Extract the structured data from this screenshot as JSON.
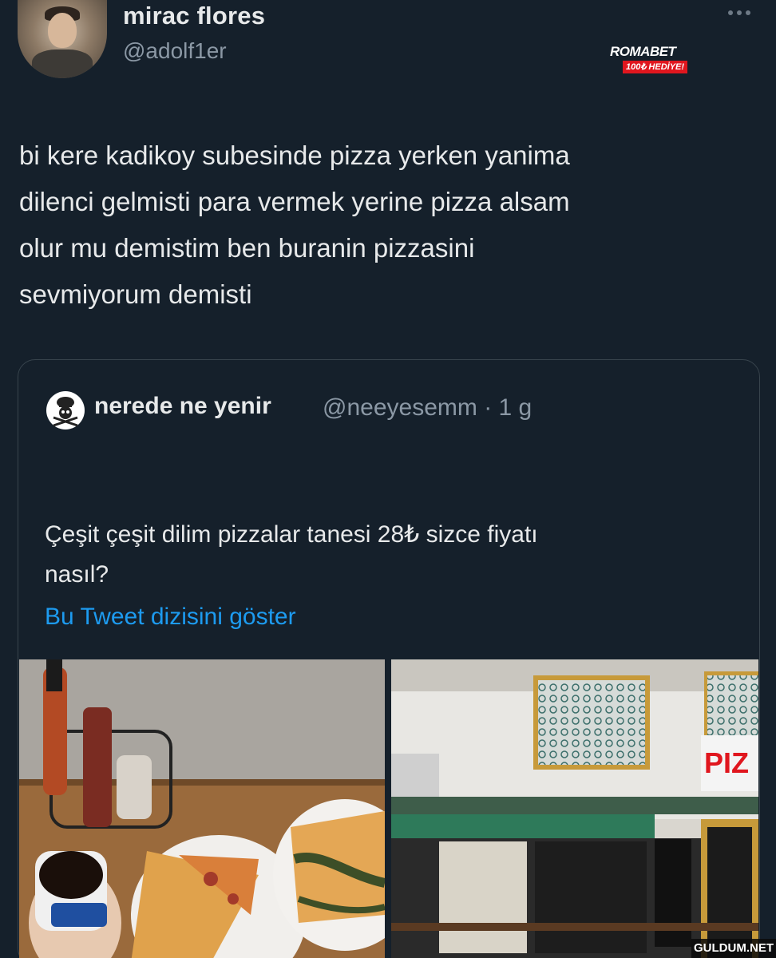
{
  "author": {
    "display_name": "mirac flores",
    "handle": "@adolf1er"
  },
  "ad": {
    "brand": "ROMABET",
    "promo": "100₺ HEDİYE!"
  },
  "tweet": {
    "lines": [
      "bi kere kadikoy subesinde pizza yerken yanima",
      "dilenci gelmisti para vermek yerine pizza alsam",
      "olur mu demistim ben buranin pizzasini",
      "sevmiyorum demisti"
    ]
  },
  "quoted": {
    "name": "nerede ne yenir",
    "meta": "@neeyesemm · 1 g",
    "text_lines": [
      "Çeşit çeşit dilim pizzalar tanesi 28₺ sizce fiyatı",
      "nasıl?"
    ],
    "thread_link": "Bu Tweet dizisini göster",
    "store_sign": "PIZ"
  },
  "watermark": "GULDUM.NET",
  "icons": {
    "more": "more-horizontal-icon",
    "quote_avatar": "chef-skull-icon"
  },
  "colors": {
    "background": "#15202b",
    "link": "#1d9bf0",
    "secondary_text": "#8b98a5",
    "border": "#38444d"
  }
}
